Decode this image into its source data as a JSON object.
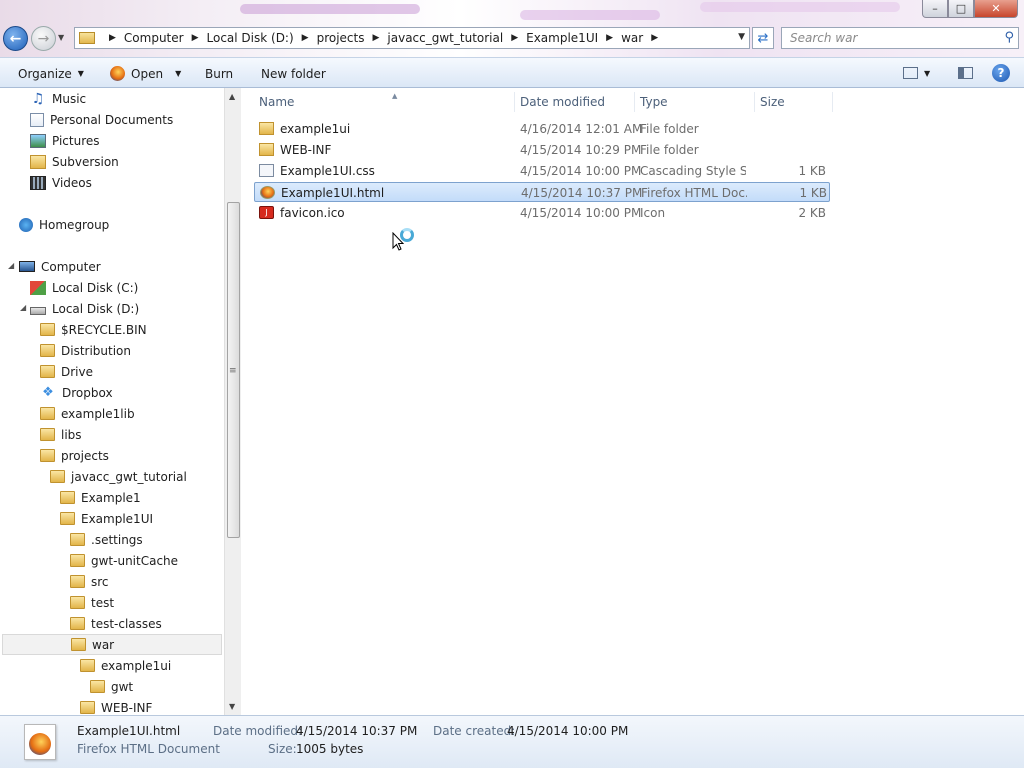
{
  "search": {
    "placeholder": "Search war"
  },
  "address": {
    "crumbs": [
      "Computer",
      "Local Disk (D:)",
      "projects",
      "javacc_gwt_tutorial",
      "Example1UI",
      "war"
    ]
  },
  "window": {
    "min": "–",
    "max": "□",
    "close": "✕"
  },
  "toolbar": {
    "organize": "Organize",
    "open": "Open",
    "burn": "Burn",
    "new_folder": "New folder",
    "help": "?"
  },
  "nav": {
    "items": [
      {
        "label": "Music",
        "icon": "music-icon"
      },
      {
        "label": "Personal Documents",
        "icon": "documents-icon"
      },
      {
        "label": "Pictures",
        "icon": "pictures-icon"
      },
      {
        "label": "Subversion",
        "icon": "subversion-icon"
      },
      {
        "label": "Videos",
        "icon": "videos-icon"
      },
      {
        "label": "Homegroup",
        "icon": "homegroup-icon"
      },
      {
        "label": "Computer",
        "icon": "computer-icon"
      },
      {
        "label": "Local Disk (C:)",
        "icon": "windows-drive-icon"
      },
      {
        "label": "Local Disk (D:)",
        "icon": "drive-icon"
      },
      {
        "label": "$RECYCLE.BIN",
        "icon": "folder-icon"
      },
      {
        "label": "Distribution",
        "icon": "folder-icon"
      },
      {
        "label": "Drive",
        "icon": "folder-icon"
      },
      {
        "label": "Dropbox",
        "icon": "dropbox-icon"
      },
      {
        "label": "example1lib",
        "icon": "folder-icon"
      },
      {
        "label": "libs",
        "icon": "folder-icon"
      },
      {
        "label": "projects",
        "icon": "folder-icon"
      },
      {
        "label": "javacc_gwt_tutorial",
        "icon": "folder-icon"
      },
      {
        "label": "Example1",
        "icon": "folder-icon"
      },
      {
        "label": "Example1UI",
        "icon": "folder-icon"
      },
      {
        "label": ".settings",
        "icon": "folder-icon"
      },
      {
        "label": "gwt-unitCache",
        "icon": "folder-icon"
      },
      {
        "label": "src",
        "icon": "folder-icon"
      },
      {
        "label": "test",
        "icon": "folder-icon"
      },
      {
        "label": "test-classes",
        "icon": "folder-icon"
      },
      {
        "label": "war",
        "icon": "folder-icon",
        "selected": true
      },
      {
        "label": "example1ui",
        "icon": "folder-icon"
      },
      {
        "label": "gwt",
        "icon": "folder-icon"
      },
      {
        "label": "WEB-INF",
        "icon": "folder-icon"
      }
    ]
  },
  "columns": {
    "name": "Name",
    "date": "Date modified",
    "type": "Type",
    "size": "Size"
  },
  "files": [
    {
      "name": "example1ui",
      "date": "4/16/2014 12:01 AM",
      "type": "File folder",
      "size": "",
      "icon": "folder-icon"
    },
    {
      "name": "WEB-INF",
      "date": "4/15/2014 10:29 PM",
      "type": "File folder",
      "size": "",
      "icon": "folder-icon"
    },
    {
      "name": "Example1UI.css",
      "date": "4/15/2014 10:00 PM",
      "type": "Cascading Style S...",
      "size": "1 KB",
      "icon": "css-file-icon"
    },
    {
      "name": "Example1UI.html",
      "date": "4/15/2014 10:37 PM",
      "type": "Firefox HTML Doc...",
      "size": "1 KB",
      "icon": "firefox-html-icon",
      "selected": true
    },
    {
      "name": "favicon.ico",
      "date": "4/15/2014 10:00 PM",
      "type": "Icon",
      "size": "2 KB",
      "icon": "ico-file-icon"
    }
  ],
  "details": {
    "filename": "Example1UI.html",
    "filetype": "Firefox HTML Document",
    "modified_label": "Date modified:",
    "modified_value": "4/15/2014 10:37 PM",
    "created_label": "Date created:",
    "created_value": "4/15/2014 10:00 PM",
    "size_label": "Size:",
    "size_value": "1005 bytes"
  }
}
